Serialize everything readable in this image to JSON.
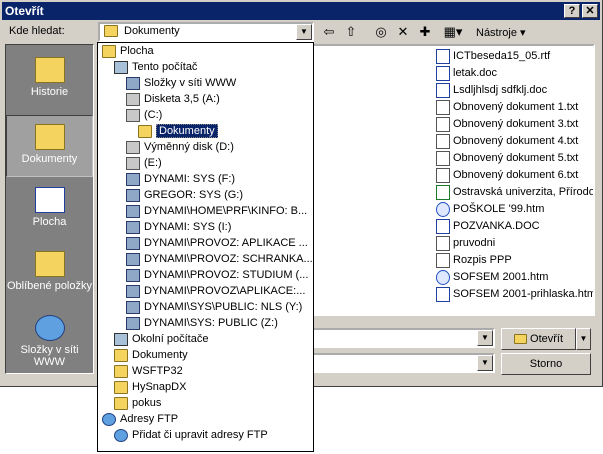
{
  "window": {
    "title": "Otevřít",
    "help_btn": "?",
    "close_btn": "✕"
  },
  "toolbar": {
    "lookin_label": "Kde hledat:",
    "lookin_value": "Dokumenty",
    "tools_label": "Nástroje"
  },
  "places": [
    {
      "label": "Historie",
      "icon": "history-folder-icon"
    },
    {
      "label": "Dokumenty",
      "icon": "documents-folder-icon"
    },
    {
      "label": "Plocha",
      "icon": "desktop-icon"
    },
    {
      "label": "Oblíbené položky",
      "icon": "favorites-icon"
    },
    {
      "label": "Složky v síti WWW",
      "icon": "web-folders-icon"
    }
  ],
  "files": [
    {
      "name": "ICTbeseda15_05.rtf",
      "icon": "doc"
    },
    {
      "name": "letak.doc",
      "icon": "doc"
    },
    {
      "name": "Lsdljhlsdj sdfklj.doc",
      "icon": "doc"
    },
    {
      "name": "Obnovený dokument 1.txt",
      "icon": "txt"
    },
    {
      "name": "Obnovený dokument 3.txt",
      "icon": "txt"
    },
    {
      "name": "Obnovený dokument 4.txt",
      "icon": "txt"
    },
    {
      "name": "Obnovený dokument 5.txt",
      "icon": "txt"
    },
    {
      "name": "Obnovený dokument 6.txt",
      "icon": "txt"
    },
    {
      "name": "Ostravská univerzita, Přírodo",
      "icon": "xls"
    },
    {
      "name": "POŠKOLE '99.htm",
      "icon": "htm"
    },
    {
      "name": "POZVANKA.DOC",
      "icon": "doc"
    },
    {
      "name": "pruvodni",
      "icon": "txt"
    },
    {
      "name": "Rozpis PPP",
      "icon": "txt"
    },
    {
      "name": "SOFSEM 2001.htm",
      "icon": "htm"
    },
    {
      "name": "SOFSEM 2001-prihlaska.htm",
      "icon": "doc"
    }
  ],
  "dropdown": [
    {
      "label": "Plocha",
      "icon": "desktop"
    },
    {
      "label": "Tento počítač",
      "icon": "comp"
    },
    {
      "label": "Složky v síti WWW",
      "icon": "net"
    },
    {
      "label": "Disketa 3,5 (A:)",
      "icon": "drive"
    },
    {
      "label": "(C:)",
      "icon": "drive"
    },
    {
      "label": "Dokumenty",
      "icon": "folder",
      "selected": true
    },
    {
      "label": "Výměnný disk (D:)",
      "icon": "drive"
    },
    {
      "label": "(E:)",
      "icon": "drive"
    },
    {
      "label": "DYNAMI: SYS (F:)",
      "icon": "net"
    },
    {
      "label": "GREGOR: SYS (G:)",
      "icon": "net"
    },
    {
      "label": "DYNAMI\\HOME\\PRF\\KINFO: B...",
      "icon": "net"
    },
    {
      "label": "DYNAMI: SYS (I:)",
      "icon": "net"
    },
    {
      "label": "DYNAMI\\PROVOZ: APLIKACE ...",
      "icon": "net"
    },
    {
      "label": "DYNAMI\\PROVOZ: SCHRANKA...",
      "icon": "net"
    },
    {
      "label": "DYNAMI\\PROVOZ: STUDIUM (...",
      "icon": "net"
    },
    {
      "label": "DYNAMI\\PROVOZ\\APLIKACE:...",
      "icon": "net"
    },
    {
      "label": "DYNAMI\\SYS\\PUBLIC: NLS (Y:)",
      "icon": "net"
    },
    {
      "label": "DYNAMI\\SYS: PUBLIC (Z:)",
      "icon": "net"
    },
    {
      "label": "Okolní počítače",
      "icon": "comp"
    },
    {
      "label": "Dokumenty",
      "icon": "folder"
    },
    {
      "label": "WSFTP32",
      "icon": "folder"
    },
    {
      "label": "HySnapDX",
      "icon": "folder"
    },
    {
      "label": "pokus",
      "icon": "folder"
    },
    {
      "label": "Adresy FTP",
      "icon": "glob"
    },
    {
      "label": "Přidat či upravit adresy FTP",
      "icon": "glob"
    }
  ],
  "buttons": {
    "open": "Otevřít",
    "cancel": "Storno"
  }
}
